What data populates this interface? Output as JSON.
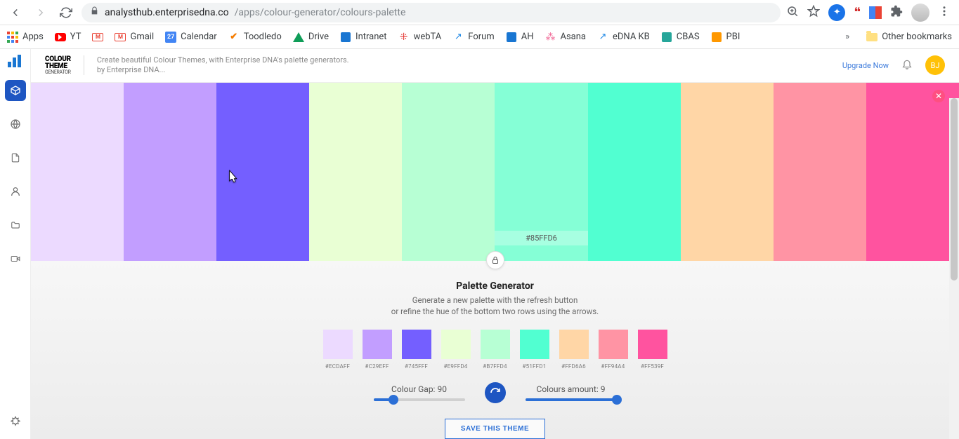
{
  "browser": {
    "url_host": "analysthub.enterprisedna.co",
    "url_path": "/apps/colour-generator/colours-palette"
  },
  "bookmarks": {
    "items": [
      {
        "label": "Apps",
        "icon": "apps"
      },
      {
        "label": "YT",
        "icon": "yt"
      },
      {
        "label": "",
        "icon": "gmail-badge"
      },
      {
        "label": "Gmail",
        "icon": "gmail"
      },
      {
        "label": "Calendar",
        "icon": "cal",
        "badge": "27"
      },
      {
        "label": "Toodledo",
        "icon": "check"
      },
      {
        "label": "Drive",
        "icon": "drive"
      },
      {
        "label": "Intranet",
        "icon": "intranet"
      },
      {
        "label": "webTA",
        "icon": "webta"
      },
      {
        "label": "Forum",
        "icon": "forum"
      },
      {
        "label": "AH",
        "icon": "ah"
      },
      {
        "label": "Asana",
        "icon": "asana"
      },
      {
        "label": "eDNA KB",
        "icon": "edna"
      },
      {
        "label": "CBAS",
        "icon": "cbas"
      },
      {
        "label": "PBI",
        "icon": "pbi"
      }
    ],
    "other_label": "Other bookmarks"
  },
  "header": {
    "logo_line1": "COLOUR",
    "logo_line2": "THEME",
    "logo_sub": "GENERATOR",
    "tagline1": "Create beautiful Colour Themes, with Enterprise DNA's palette generators.",
    "tagline2": "by Enterprise DNA...",
    "upgrade": "Upgrade Now",
    "avatar": "BJ"
  },
  "palette": {
    "colors": [
      "#ECDAFF",
      "#C29EFF",
      "#745FFF",
      "#E9FFD4",
      "#B7FFD4",
      "#85FFD6",
      "#51FFD1",
      "#FFD6A6",
      "#FF94A4",
      "#FF539F"
    ],
    "selected_index": 5,
    "selected_hex": "#85FFD6"
  },
  "generator": {
    "title": "Palette Generator",
    "subtitle1": "Generate a new palette with the refresh button",
    "subtitle2": "or refine the hue of the bottom two rows using the arrows.",
    "swatches": [
      {
        "hex": "#ECDAFF"
      },
      {
        "hex": "#C29EFF"
      },
      {
        "hex": "#745FFF"
      },
      {
        "hex": "#E9FFD4"
      },
      {
        "hex": "#B7FFD4"
      },
      {
        "hex": "#51FFD1"
      },
      {
        "hex": "#FFD6A6"
      },
      {
        "hex": "#FF94A4"
      },
      {
        "hex": "#FF539F"
      }
    ],
    "gap_label": "Colour Gap: 90",
    "gap_pct": 22,
    "amount_label": "Colours amount: 9",
    "amount_pct": 100,
    "save_label": "SAVE THIS THEME"
  }
}
